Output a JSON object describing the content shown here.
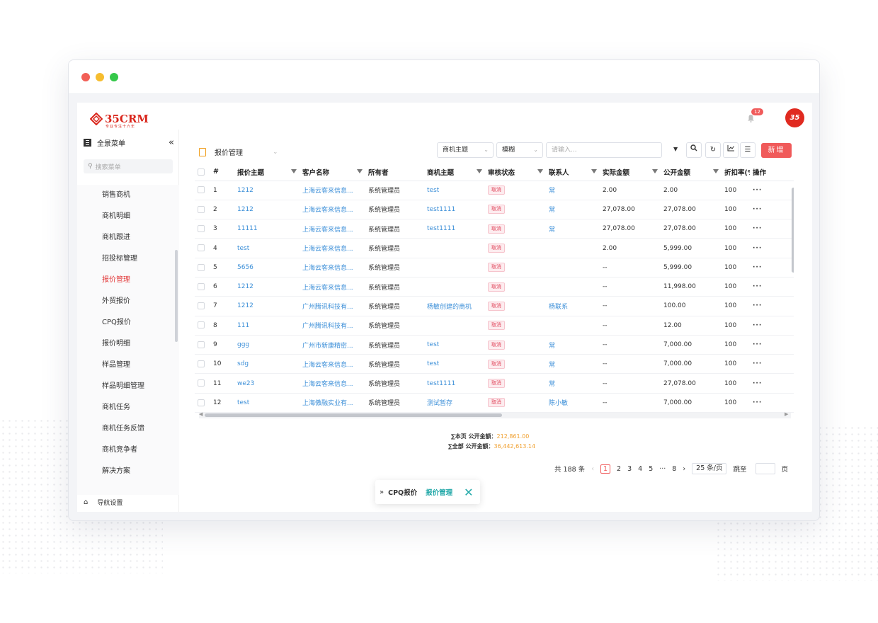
{
  "logo": {
    "text": "35CRM",
    "subtitle": "专业专注十六年"
  },
  "header": {
    "notification_count": "12",
    "avatar_text": "35"
  },
  "sidebar": {
    "title": "全景菜单",
    "collapse_icon": "«",
    "search_placeholder": "搜索菜单",
    "items": [
      {
        "label": "销售商机"
      },
      {
        "label": "商机明细"
      },
      {
        "label": "商机跟进"
      },
      {
        "label": "招投标管理"
      },
      {
        "label": "报价管理"
      },
      {
        "label": "外贸报价"
      },
      {
        "label": "CPQ报价"
      },
      {
        "label": "报价明细"
      },
      {
        "label": "样品管理"
      },
      {
        "label": "样品明细管理"
      },
      {
        "label": "商机任务"
      },
      {
        "label": "商机任务反馈"
      },
      {
        "label": "商机竞争者"
      },
      {
        "label": "解决方案"
      }
    ],
    "footer": "导航设置"
  },
  "toolbar": {
    "title": "报价管理",
    "field_select": "商机主题",
    "match_select": "模糊",
    "search_placeholder": "请输入...",
    "add_label": "新增"
  },
  "table": {
    "columns": [
      "#",
      "报价主题",
      "客户名称",
      "所有者",
      "商机主题",
      "审核状态",
      "联系人",
      "实际金额",
      "公开金额",
      "折扣率(%",
      "操作"
    ],
    "rows": [
      [
        "1",
        "1212",
        "上海云客来信息...",
        "系统管理员",
        "test",
        "取消",
        "常",
        "2.00",
        "2.00",
        "100"
      ],
      [
        "2",
        "1212",
        "上海云客来信息...",
        "系统管理员",
        "test1111",
        "取消",
        "常",
        "27,078.00",
        "27,078.00",
        "100"
      ],
      [
        "3",
        "11111",
        "上海云客来信息...",
        "系统管理员",
        "test1111",
        "取消",
        "常",
        "27,078.00",
        "27,078.00",
        "100"
      ],
      [
        "4",
        "test",
        "上海云客来信息...",
        "系统管理员",
        "",
        "取消",
        "",
        "2.00",
        "5,999.00",
        "100"
      ],
      [
        "5",
        "5656",
        "上海云客来信息...",
        "系统管理员",
        "",
        "取消",
        "",
        "--",
        "5,999.00",
        "100"
      ],
      [
        "6",
        "1212",
        "上海云客来信息...",
        "系统管理员",
        "",
        "取消",
        "",
        "--",
        "11,998.00",
        "100"
      ],
      [
        "7",
        "1212",
        "广州腾讯科技有...",
        "系统管理员",
        "杨敏创建的商机",
        "取消",
        "杨联系",
        "--",
        "100.00",
        "100"
      ],
      [
        "8",
        "111",
        "广州腾讯科技有...",
        "系统管理员",
        "",
        "取消",
        "",
        "--",
        "12.00",
        "100"
      ],
      [
        "9",
        "ggg",
        "广州市新康精密...",
        "系统管理员",
        "test",
        "取消",
        "常",
        "--",
        "7,000.00",
        "100"
      ],
      [
        "10",
        "sdg",
        "上海云客来信息...",
        "系统管理员",
        "test",
        "取消",
        "常",
        "--",
        "7,000.00",
        "100"
      ],
      [
        "11",
        "we23",
        "上海云客来信息...",
        "系统管理员",
        "test1111",
        "取消",
        "常",
        "--",
        "27,078.00",
        "100"
      ],
      [
        "12",
        "test",
        "上海傲融实业有...",
        "系统管理员",
        "测试暂存",
        "取消",
        "陈小敏",
        "--",
        "7,000.00",
        "100"
      ]
    ],
    "more_icon": "···"
  },
  "summary": {
    "page_label": "∑本页 公开金额：",
    "page_value": "212,861.00",
    "all_label": "∑全部 公开金额：",
    "all_value": "36,442,613.14"
  },
  "pager": {
    "total": "共 188 条",
    "pages": [
      "1",
      "2",
      "3",
      "4",
      "5",
      "···",
      "8"
    ],
    "page_size": "25 条/页",
    "jump_label": "跳至",
    "jump_suffix": "页"
  },
  "taskbar": {
    "crumb1": "CPQ报价",
    "crumb2": "报价管理"
  }
}
